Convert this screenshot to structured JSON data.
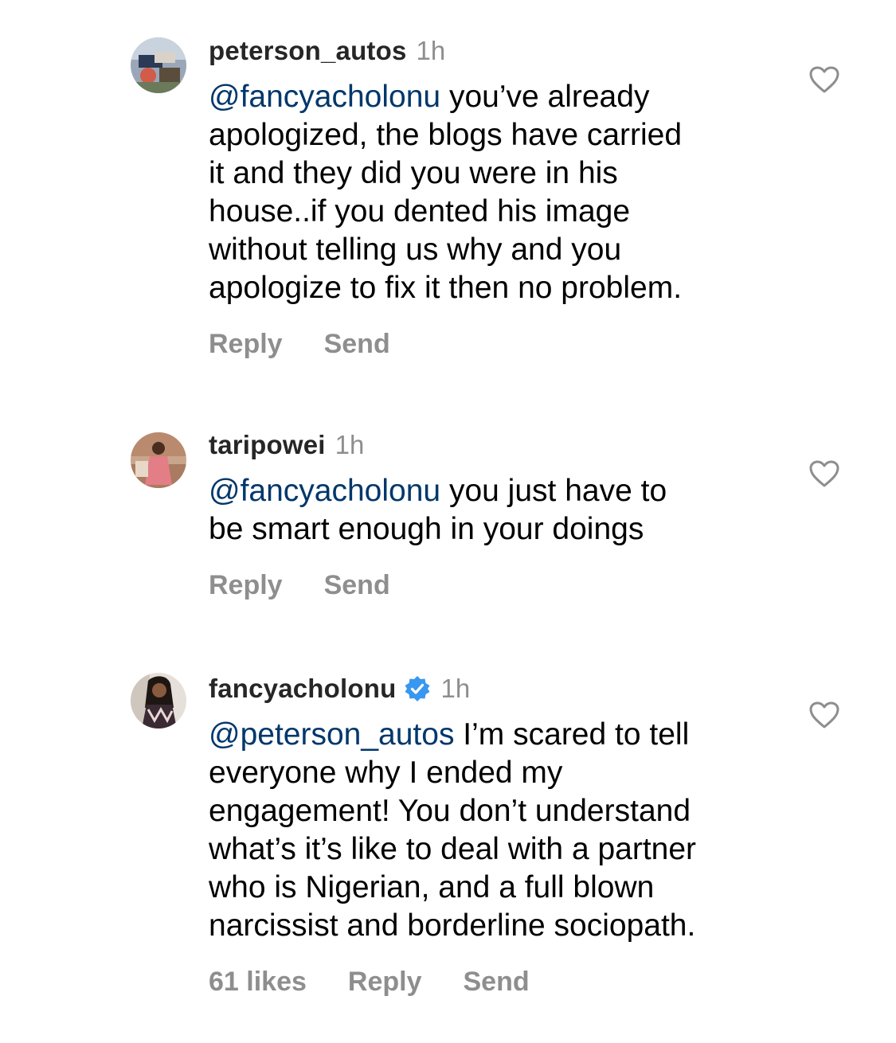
{
  "comments": [
    {
      "username": "peterson_autos",
      "time": "1h",
      "verified": false,
      "mention": "@fancyacholonu",
      "lines_first": " you’ve already",
      "lines": [
        "apologized, the blogs have carried",
        "it and they did you were in his",
        "house..if you dented his image",
        "without telling us why and you",
        "apologize to fix it then no problem."
      ],
      "reply_label": "Reply",
      "send_label": "Send",
      "avatar_icon": "avatar-photo-icon",
      "like_icon": "heart-outline-icon"
    },
    {
      "username": "taripowei",
      "time": "1h",
      "verified": false,
      "mention": "@fancyacholonu",
      "lines_first": " you just have to",
      "lines": [
        "be smart enough in your doings"
      ],
      "reply_label": "Reply",
      "send_label": "Send",
      "avatar_icon": "avatar-photo-icon",
      "like_icon": "heart-outline-icon"
    },
    {
      "username": "fancyacholonu",
      "time": "1h",
      "verified": true,
      "verified_icon": "verified-badge-icon",
      "mention": "@peterson_autos",
      "lines_first": " I’m scared to tell",
      "lines": [
        "everyone why I ended my",
        "engagement! You don’t understand",
        "what’s it’s like to deal with a partner",
        "who is Nigerian, and a full blown",
        "narcissist and borderline sociopath."
      ],
      "likes_label": "61 likes",
      "reply_label": "Reply",
      "send_label": "Send",
      "avatar_icon": "avatar-photo-icon",
      "like_icon": "heart-outline-icon"
    }
  ],
  "colors": {
    "username": "#262626",
    "meta": "#8e8e8e",
    "mention": "#00376b",
    "verified": "#3897f0"
  }
}
